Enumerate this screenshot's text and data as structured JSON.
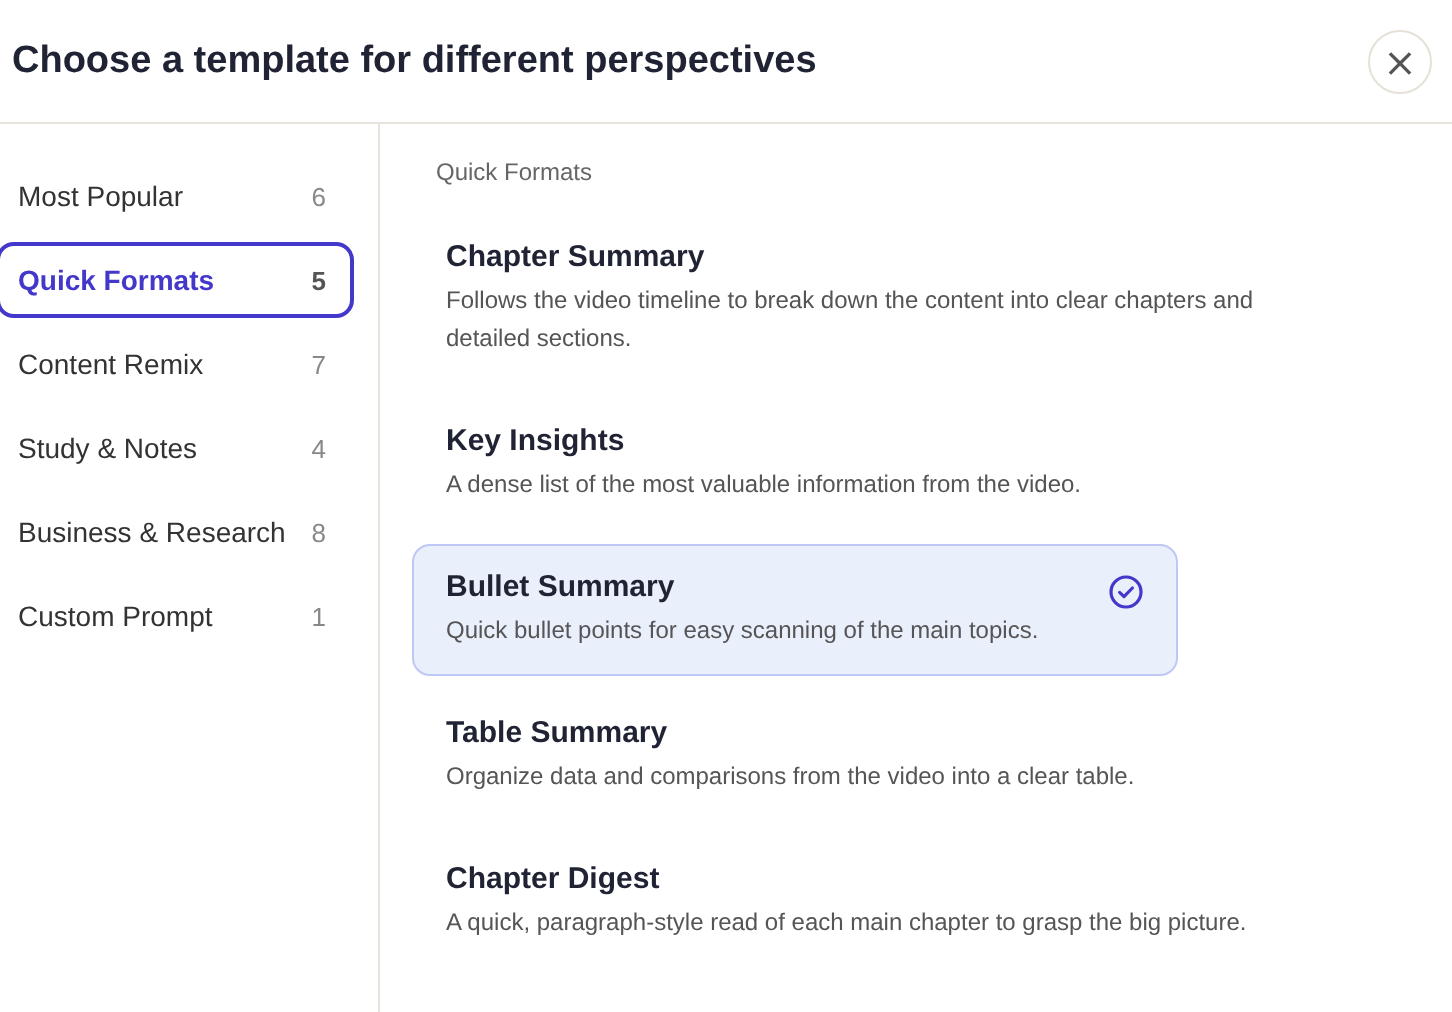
{
  "dialog": {
    "title": "Choose a template for different perspectives",
    "close": "×"
  },
  "sidebar": {
    "items": [
      {
        "label": "Most Popular",
        "count": "6",
        "selected": false
      },
      {
        "label": "Quick Formats",
        "count": "5",
        "selected": true
      },
      {
        "label": "Content Remix",
        "count": "7",
        "selected": false
      },
      {
        "label": "Study & Notes",
        "count": "4",
        "selected": false
      },
      {
        "label": "Business & Research",
        "count": "8",
        "selected": false
      },
      {
        "label": "Custom Prompt",
        "count": "1",
        "selected": false
      }
    ]
  },
  "section": {
    "heading": "Quick Formats",
    "templates": [
      {
        "title": "Chapter Summary",
        "description": "Follows the video timeline to break down the content into clear chapters and detailed sections.",
        "selected": false
      },
      {
        "title": "Key Insights",
        "description": "A dense list of the most valuable information from the video.",
        "selected": false
      },
      {
        "title": "Bullet Summary",
        "description": "Quick bullet points for easy scanning of the main topics.",
        "selected": true
      },
      {
        "title": "Table Summary",
        "description": "Organize data and comparisons from the video into a clear table.",
        "selected": false
      },
      {
        "title": "Chapter Digest",
        "description": "A quick, paragraph-style read of each main chapter to grasp the big picture.",
        "selected": false
      }
    ]
  }
}
